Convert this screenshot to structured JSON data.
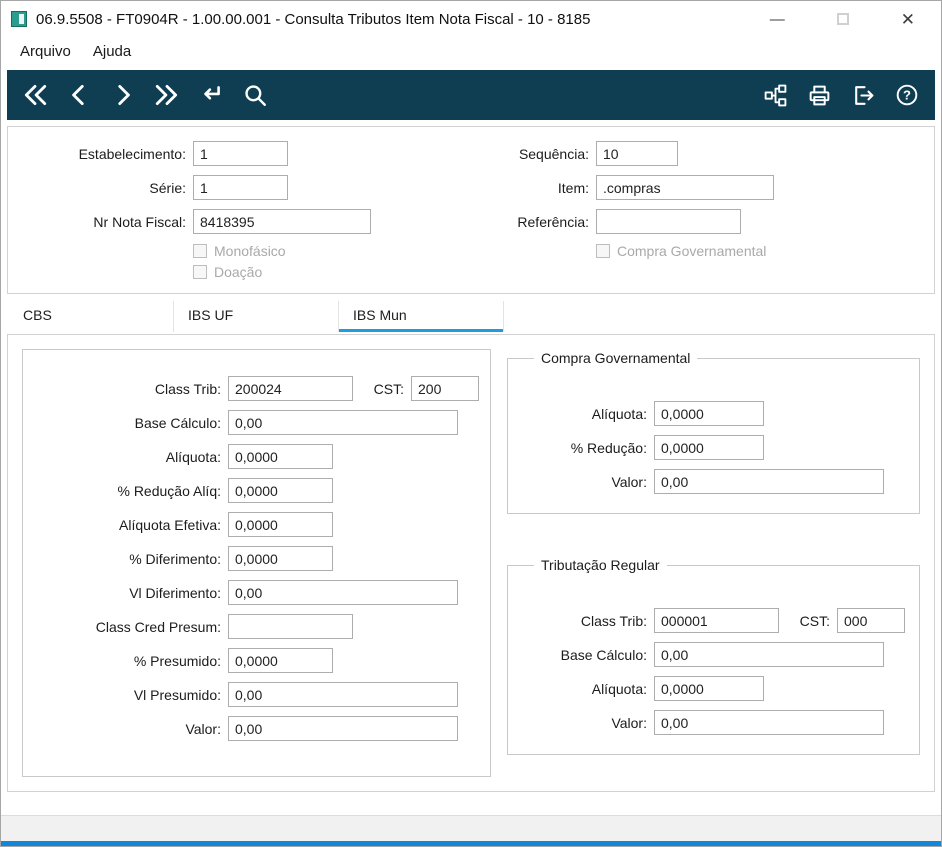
{
  "colors": {
    "toolbar_bg": "#0f3e52",
    "tab_accent": "#1e9ce0",
    "bottom_bar": "#1486d8",
    "app_icon": "#2a9d8f"
  },
  "window": {
    "title": "06.9.5508 - FT0904R - 1.00.00.001 - Consulta Tributos Item Nota Fiscal - 10 - 8185",
    "minimize_glyph": "—",
    "close_glyph": "✕"
  },
  "menubar": {
    "items": [
      {
        "label": "Arquivo"
      },
      {
        "label": "Ajuda"
      }
    ]
  },
  "toolbar": {
    "left_icons": [
      "first-record",
      "previous-record",
      "next-record",
      "last-record",
      "enter-query",
      "search"
    ],
    "right_icons": [
      "program-flow",
      "print",
      "exit",
      "help"
    ],
    "help_glyph": "?"
  },
  "header": {
    "estabelecimento": {
      "label": "Estabelecimento:",
      "value": "1"
    },
    "serie": {
      "label": "Série:",
      "value": "1"
    },
    "nr_nota_fiscal": {
      "label": "Nr Nota Fiscal:",
      "value": "8418395"
    },
    "sequencia": {
      "label": "Sequência:",
      "value": "10"
    },
    "item": {
      "label": "Item:",
      "value": ".compras"
    },
    "referencia": {
      "label": "Referência:",
      "value": ""
    },
    "monofasico": {
      "label": "Monofásico",
      "checked": false
    },
    "doacao": {
      "label": "Doação",
      "checked": false
    },
    "compra_governamental": {
      "label": "Compra Governamental",
      "checked": false
    }
  },
  "tabs": [
    {
      "label": "CBS",
      "active": false
    },
    {
      "label": "IBS UF",
      "active": false
    },
    {
      "label": "IBS Mun",
      "active": true
    }
  ],
  "ibs_mun": {
    "left": {
      "class_trib": {
        "label": "Class Trib:",
        "value": "200024"
      },
      "cst": {
        "label": "CST:",
        "value": "200"
      },
      "base_calculo": {
        "label": "Base Cálculo:",
        "value": "0,00"
      },
      "aliquota": {
        "label": "Alíquota:",
        "value": "0,0000"
      },
      "perc_reducao_aliq": {
        "label": "% Redução Alíq:",
        "value": "0,0000"
      },
      "aliquota_efetiva": {
        "label": "Alíquota Efetiva:",
        "value": "0,0000"
      },
      "perc_diferimento": {
        "label": "% Diferimento:",
        "value": "0,0000"
      },
      "vl_diferimento": {
        "label": "Vl Diferimento:",
        "value": "0,00"
      },
      "class_cred_presum": {
        "label": "Class Cred Presum:",
        "value": ""
      },
      "perc_presumido": {
        "label": "% Presumido:",
        "value": "0,0000"
      },
      "vl_presumido": {
        "label": "Vl Presumido:",
        "value": "0,00"
      },
      "valor": {
        "label": "Valor:",
        "value": "0,00"
      }
    },
    "compra_governamental": {
      "title": "Compra Governamental",
      "aliquota": {
        "label": "Alíquota:",
        "value": "0,0000"
      },
      "perc_reducao": {
        "label": "% Redução:",
        "value": "0,0000"
      },
      "valor": {
        "label": "Valor:",
        "value": "0,00"
      }
    },
    "tributacao_regular": {
      "title": "Tributação Regular",
      "class_trib": {
        "label": "Class Trib:",
        "value": "000001"
      },
      "cst": {
        "label": "CST:",
        "value": "000"
      },
      "base_calculo": {
        "label": "Base Cálculo:",
        "value": "0,00"
      },
      "aliquota": {
        "label": "Alíquota:",
        "value": "0,0000"
      },
      "valor": {
        "label": "Valor:",
        "value": "0,00"
      }
    }
  }
}
